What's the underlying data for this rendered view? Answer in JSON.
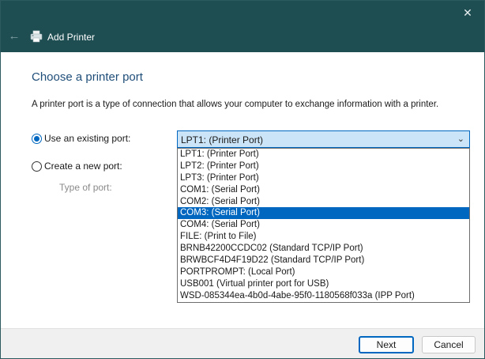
{
  "titlebar": {
    "title": "Add Printer",
    "close_icon": "close-icon",
    "back_icon": "back-arrow-icon",
    "app_icon": "printer-icon"
  },
  "main": {
    "heading": "Choose a printer port",
    "description": "A printer port is a type of connection that allows your computer to exchange information with a printer.",
    "existing_port": {
      "label": "Use an existing port:",
      "checked": true
    },
    "new_port": {
      "label": "Create a new port:",
      "checked": false
    },
    "type_of_port_label": "Type of port:",
    "port_combo": {
      "value": "LPT1: (Printer Port)"
    },
    "port_options": [
      "LPT1: (Printer Port)",
      "LPT2: (Printer Port)",
      "LPT3: (Printer Port)",
      "COM1: (Serial Port)",
      "COM2: (Serial Port)",
      "COM3: (Serial Port)",
      "COM4: (Serial Port)",
      "FILE: (Print to File)",
      "BRNB42200CCDC02 (Standard TCP/IP Port)",
      "BRWBCF4D4F19D22 (Standard TCP/IP Port)",
      "PORTPROMPT: (Local Port)",
      "USB001 (Virtual printer port for USB)",
      "WSD-085344ea-4b0d-4abe-95f0-1180568f033a (IPP Port)"
    ],
    "highlighted_option": "COM3: (Serial Port)"
  },
  "footer": {
    "next_label": "Next",
    "cancel_label": "Cancel"
  },
  "colors": {
    "titlebar": "#1e4d52",
    "accent": "#0067c0",
    "heading": "#1f4e79"
  }
}
